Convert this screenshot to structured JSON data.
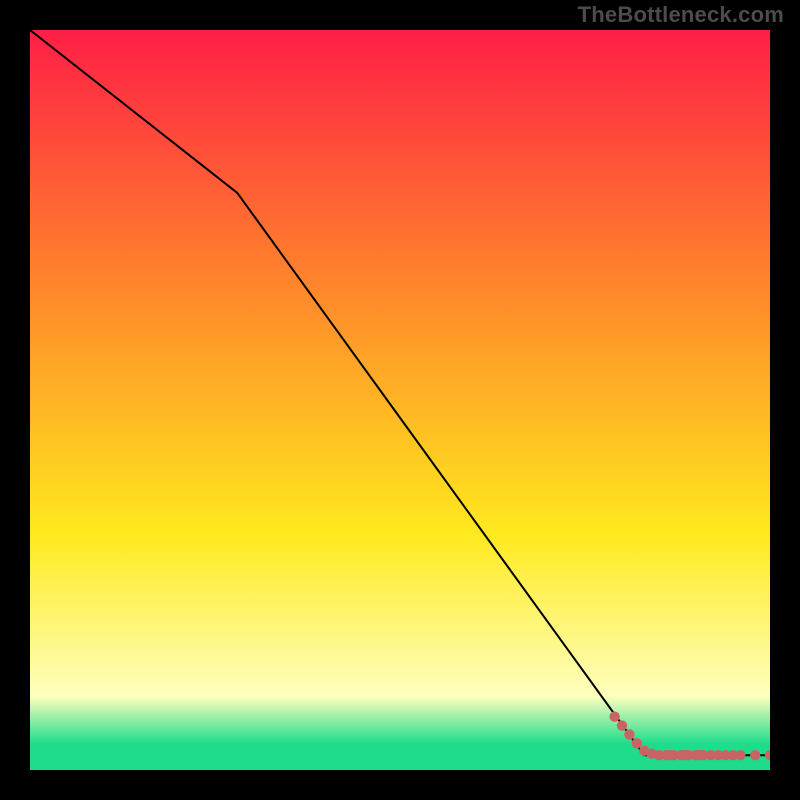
{
  "watermark": "TheBottleneck.com",
  "colors": {
    "frame": "#000000",
    "line": "#000000",
    "point": "#c86464",
    "gradient_top": "#ff1e46",
    "gradient_mid_upper": "#ff8a2a",
    "gradient_mid": "#ffe91e",
    "gradient_pale": "#ffffbe",
    "gradient_green": "#1edc8c"
  },
  "chart_data": {
    "type": "line",
    "title": "",
    "xlabel": "",
    "ylabel": "",
    "xlim": [
      0,
      100
    ],
    "ylim": [
      0,
      100
    ],
    "series": [
      {
        "name": "curve",
        "x": [
          0,
          28,
          83,
          100
        ],
        "y": [
          100,
          78,
          2,
          2
        ]
      }
    ],
    "points": {
      "name": "cluster",
      "x": [
        79,
        80,
        81,
        82,
        83,
        84,
        85,
        86,
        86.5,
        87,
        88,
        88.5,
        89,
        90,
        90.5,
        91,
        92,
        93,
        94,
        95,
        96,
        98,
        100
      ],
      "y": [
        7.2,
        6.0,
        4.8,
        3.6,
        2.6,
        2.2,
        2.0,
        2.0,
        2.0,
        2.0,
        2.0,
        2.0,
        2.0,
        2.0,
        2.0,
        2.0,
        2.0,
        2.0,
        2.0,
        2.0,
        2.0,
        2.0,
        2.0
      ]
    }
  }
}
